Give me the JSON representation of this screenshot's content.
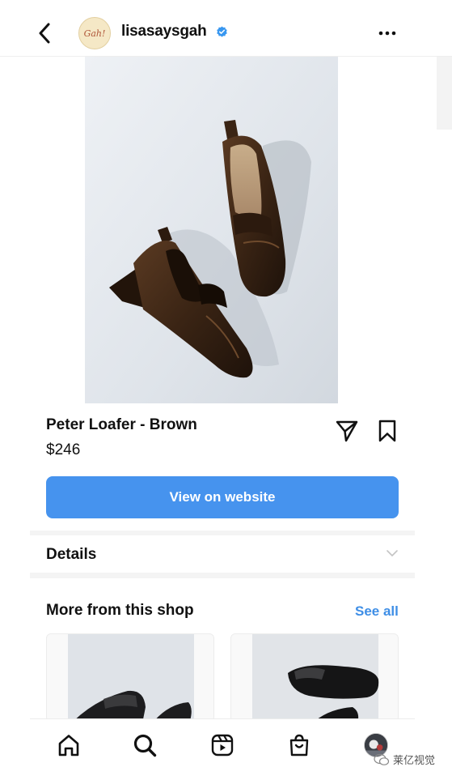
{
  "header": {
    "account_name": "lisasaysgah",
    "avatar_text": "Gah!",
    "verified": true,
    "icons": {
      "back": "chevron-left-icon",
      "more": "more-horizontal-icon",
      "verified": "verified-badge-icon"
    }
  },
  "product": {
    "title": "Peter Loafer - Brown",
    "price": "$246",
    "cta_label": "View on website",
    "icons": {
      "share": "send-icon",
      "save": "bookmark-icon"
    }
  },
  "details": {
    "label": "Details",
    "icon": "chevron-down-icon"
  },
  "more_from_shop": {
    "heading": "More from this shop",
    "see_all_label": "See all",
    "items_visible": 2
  },
  "bottom_nav": {
    "items": [
      "home-icon",
      "search-icon",
      "reels-icon",
      "shop-icon",
      "profile-avatar"
    ]
  },
  "watermark": {
    "text": "莱亿视觉"
  },
  "colors": {
    "accent": "#4693ee",
    "link": "#3e8ee6",
    "verified": "#3897f0",
    "text": "#111111"
  }
}
